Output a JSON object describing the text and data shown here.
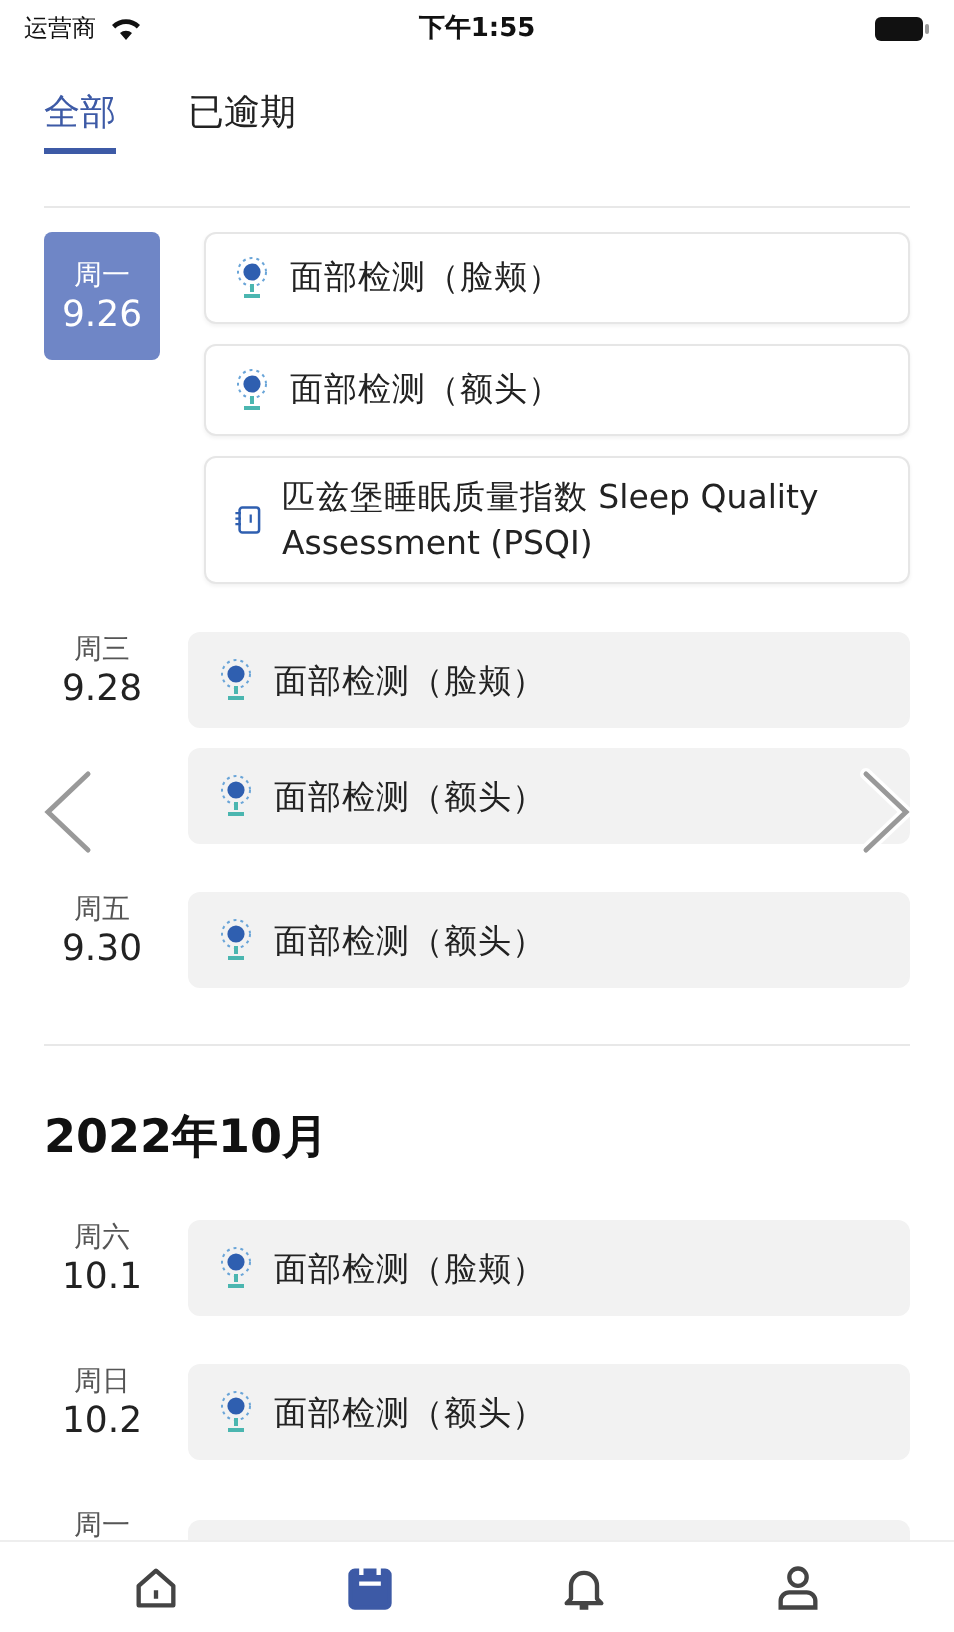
{
  "status_bar": {
    "carrier": "运营商",
    "time": "下午1:55"
  },
  "tabs": [
    {
      "label": "全部",
      "selected": true
    },
    {
      "label": "已逾期",
      "selected": false
    }
  ],
  "sections": [
    {
      "days": [
        {
          "weekday": "周一",
          "date": "9.26",
          "selected": true,
          "items": [
            {
              "kind": "face-scan",
              "title": "面部检测（脸颊）"
            },
            {
              "kind": "face-scan",
              "title": "面部检测（额头）"
            },
            {
              "kind": "questionnaire",
              "title": "匹兹堡睡眠质量指数 Sleep Quality Assessment (PSQI)"
            }
          ]
        },
        {
          "weekday": "周三",
          "date": "9.28",
          "selected": false,
          "items": [
            {
              "kind": "face-scan",
              "title": "面部检测（脸颊）"
            },
            {
              "kind": "face-scan",
              "title": "面部检测（额头）"
            }
          ]
        },
        {
          "weekday": "周五",
          "date": "9.30",
          "selected": false,
          "items": [
            {
              "kind": "face-scan",
              "title": "面部检测（额头）"
            }
          ]
        }
      ]
    },
    {
      "month": "2022年10月",
      "days": [
        {
          "weekday": "周六",
          "date": "10.1",
          "selected": false,
          "items": [
            {
              "kind": "face-scan",
              "title": "面部检测（脸颊）"
            }
          ]
        },
        {
          "weekday": "周日",
          "date": "10.2",
          "selected": false,
          "items": [
            {
              "kind": "face-scan",
              "title": "面部检测（额头）"
            }
          ]
        },
        {
          "weekday": "周一",
          "selected": false,
          "peek": true
        }
      ]
    }
  ],
  "bottom_nav": [
    {
      "kind": "home",
      "selected": false
    },
    {
      "kind": "calendar",
      "selected": true
    },
    {
      "kind": "bell",
      "selected": false
    },
    {
      "kind": "person",
      "selected": false
    }
  ]
}
